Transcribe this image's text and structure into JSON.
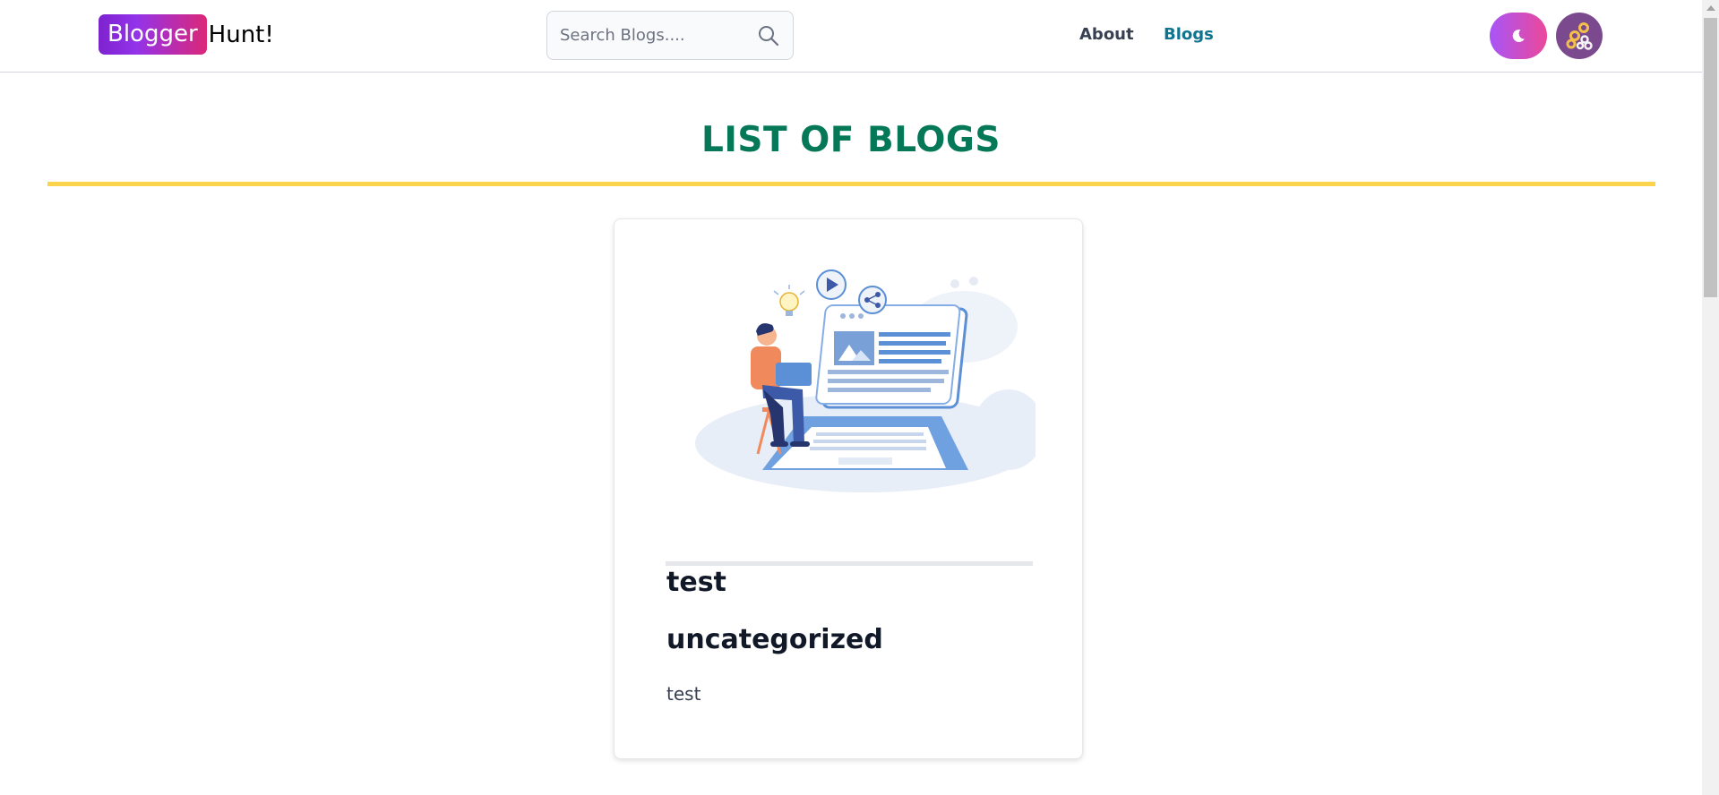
{
  "header": {
    "logo_badge": "Blogger",
    "logo_rest": "Hunt!",
    "search_placeholder": "Search Blogs....",
    "nav": [
      {
        "label": "About"
      },
      {
        "label": "Blogs"
      }
    ],
    "icons": {
      "search": "search-icon",
      "theme_toggle": "moon-icon",
      "avatar": "avatar-icon"
    }
  },
  "main": {
    "title": "LIST OF BLOGS",
    "cards": [
      {
        "title": "test",
        "category": "uncategorized",
        "description": "test",
        "image": "blogging-illustration"
      }
    ]
  },
  "colors": {
    "title_green": "#047857",
    "rule_yellow": "#fcd34d",
    "active_nav": "#0e7490",
    "logo_gradient_start": "#7e22ce",
    "logo_gradient_end": "#db2777"
  }
}
